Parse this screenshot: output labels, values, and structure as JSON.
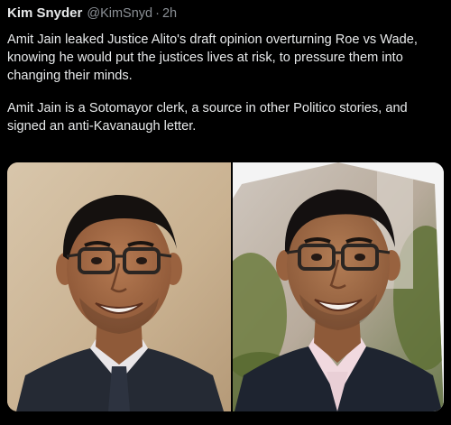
{
  "author": {
    "display_name": "Kim Snyder",
    "handle": "@KimSnyd",
    "separator": "·",
    "timestamp": "2h"
  },
  "tweet": {
    "paragraphs": [
      "Amit Jain leaked Justice Alito's draft opinion overturning Roe vs Wade, knowing he would put the justices lives at risk, to pressure them into changing their minds.",
      "Amit Jain is a Sotomayor clerk, a source in other Politico stories, and signed an anti-Kavanaugh letter."
    ]
  },
  "media": {
    "photos": [
      {
        "subject": "man-portrait",
        "background_color": "#cfb89c"
      },
      {
        "subject": "man-portrait",
        "background_color": "#f2f2f2"
      }
    ]
  },
  "colors": {
    "background": "#000000",
    "text": "#e7e9ea",
    "secondary_text": "#8b9096"
  }
}
